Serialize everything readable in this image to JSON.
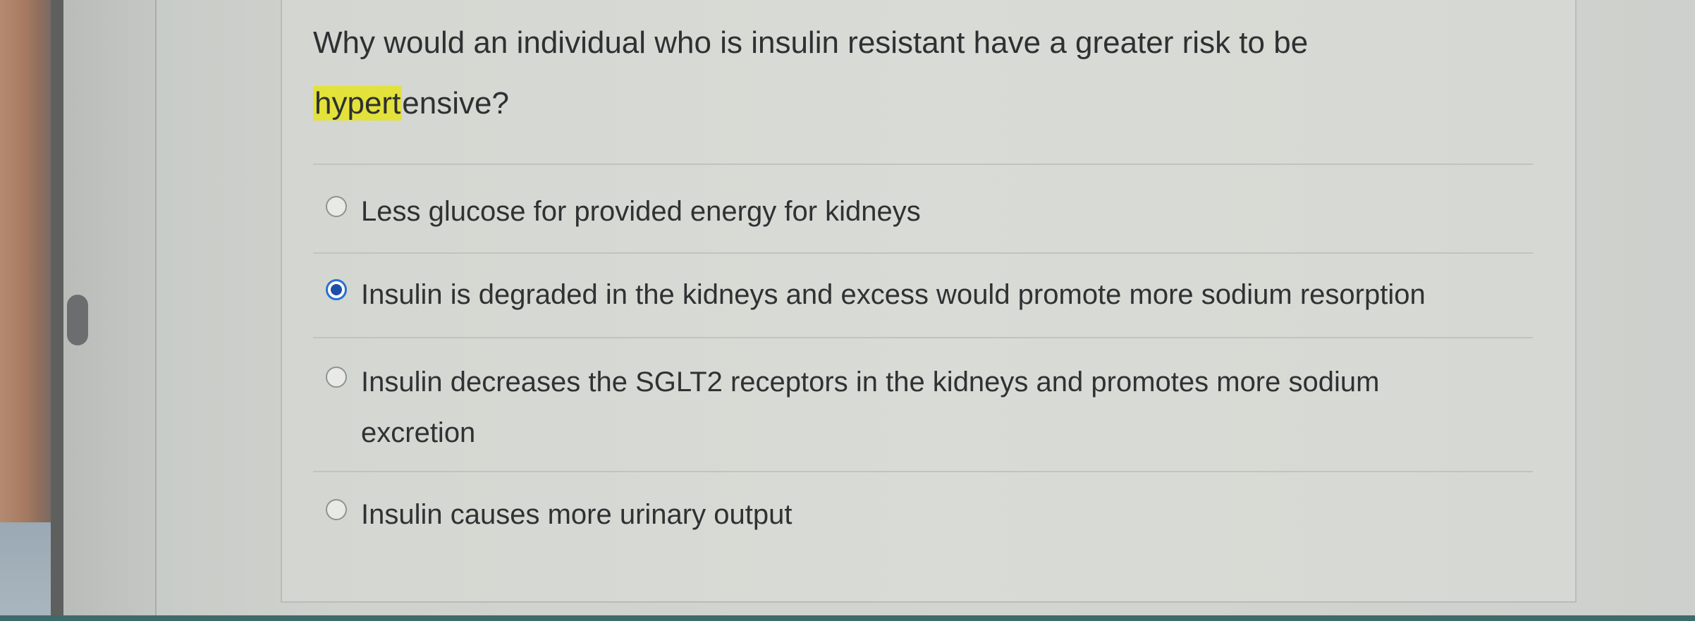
{
  "question": {
    "text_before": "Why would an individual who is insulin resistant have a greater risk to be ",
    "highlight": "hypert",
    "text_after": "ensive?"
  },
  "options": [
    {
      "label": "Less glucose for provided energy for kidneys",
      "selected": false
    },
    {
      "label": "Insulin is degraded in the kidneys and excess would promote more sodium resorption",
      "selected": true
    },
    {
      "label": "Insulin decreases the SGLT2 receptors in the kidneys and promotes more sodium excretion",
      "selected": false
    },
    {
      "label": "Insulin causes more urinary output",
      "selected": false
    }
  ],
  "colors": {
    "highlight": "#e3e23b",
    "radio_selected": "#2a6fd0"
  }
}
